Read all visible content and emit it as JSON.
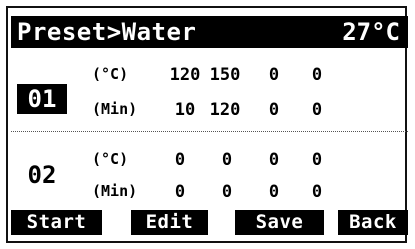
{
  "header": {
    "title": "Preset>Water",
    "temperature": "27°C"
  },
  "presets": [
    {
      "number": "01",
      "temp_label": "(°C)",
      "time_label": "(Min)",
      "temps": [
        "120",
        "150",
        "0",
        "0"
      ],
      "times": [
        "10",
        "120",
        "0",
        "0"
      ]
    },
    {
      "number": "02",
      "temp_label": "(°C)",
      "time_label": "(Min)",
      "temps": [
        "0",
        "0",
        "0",
        "0"
      ],
      "times": [
        "0",
        "0",
        "0",
        "0"
      ]
    }
  ],
  "softkeys": {
    "start": "Start",
    "edit": "Edit",
    "save": "Save",
    "back": "Back"
  },
  "colors": {
    "background": "#ffffff",
    "inverse": "#000000"
  }
}
